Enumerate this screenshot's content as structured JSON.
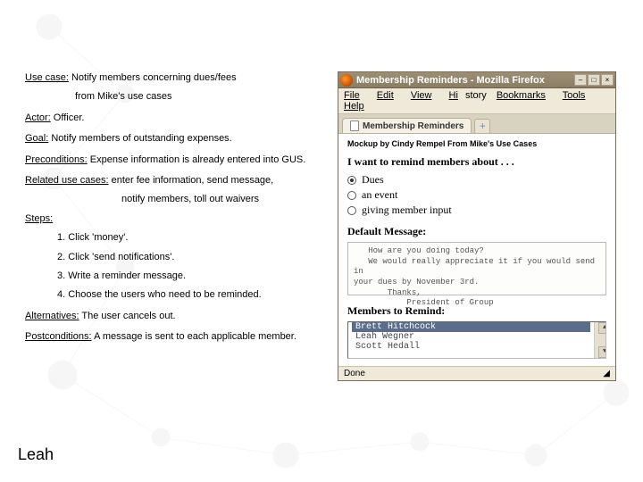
{
  "usecase": {
    "title_label": "Use case:",
    "title_text": "Notify members concerning dues/fees",
    "subtitle": "from Mike's use cases",
    "actor_label": "Actor:",
    "actor_value": "Officer.",
    "goal_label": "Goal:",
    "goal_value": "Notify members of outstanding expenses.",
    "preconditions_label": "Preconditions:",
    "preconditions_value": "Expense information is already entered into GUS.",
    "related_label": "Related use cases:",
    "related_value_line1": "enter fee information, send message,",
    "related_value_line2": "notify members, toll out waivers",
    "steps_label": "Steps:",
    "steps": [
      "1. Click 'money'.",
      "2. Click 'send notifications'.",
      "3. Write a reminder message.",
      "4. Choose the users who need to be reminded."
    ],
    "alternatives_label": "Alternatives:",
    "alternatives_value": "The user cancels out.",
    "postconditions_label": "Postconditions:",
    "postconditions_value": "A message is sent to each applicable member."
  },
  "author": "Leah",
  "browser": {
    "window_title": "Membership Reminders - Mozilla Firefox",
    "menus": [
      "File",
      "Edit",
      "View",
      "History",
      "Bookmarks",
      "Tools",
      "Help"
    ],
    "tab_label": "Membership Reminders",
    "newtab_glyph": "+",
    "min_glyph": "–",
    "max_glyph": "□",
    "close_glyph": "×",
    "status_text": "Done"
  },
  "mockup": {
    "byline": "Mockup by Cindy Rempel From Mike's Use Cases",
    "heading": "I want to remind members about . . .",
    "options": [
      {
        "label": "Dues",
        "selected": true
      },
      {
        "label": "an event",
        "selected": false
      },
      {
        "label": "giving member input",
        "selected": false
      }
    ],
    "default_msg_label": "Default Message:",
    "default_msg_text": "   How are you doing today?\n   We would really appreciate it if you would send in\nyour dues by November 3rd.\n       Thanks,\n           President of Group",
    "members_label": "Members to Remind:",
    "members": [
      "Brett Hitchcock",
      "Leah Wegner",
      "Scott Hedall"
    ],
    "selected_member_index": 0
  }
}
